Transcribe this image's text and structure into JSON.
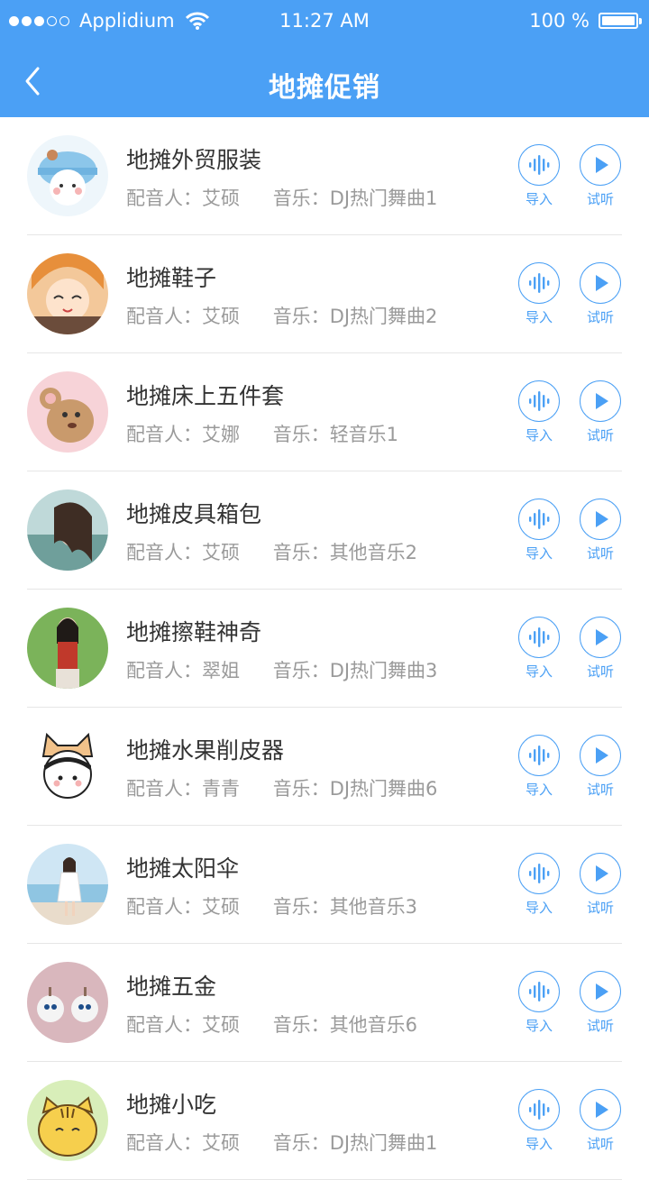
{
  "status": {
    "carrier": "Applidium",
    "time": "11:27 AM",
    "battery": "100 %"
  },
  "nav": {
    "title": "地摊促销"
  },
  "labels": {
    "voice_prefix": "配音人：",
    "music_prefix": "音乐：",
    "import": "导入",
    "listen": "试听"
  },
  "colors": {
    "accent": "#4ba0f5"
  },
  "items": [
    {
      "title": "地摊外贸服装",
      "voice": "艾硕",
      "music": "DJ热门舞曲1",
      "avatar": "bear-hat-cartoon"
    },
    {
      "title": "地摊鞋子",
      "voice": "艾硕",
      "music": "DJ热门舞曲2",
      "avatar": "anime-girl"
    },
    {
      "title": "地摊床上五件套",
      "voice": "艾娜",
      "music": "轻音乐1",
      "avatar": "cartoon-mouse"
    },
    {
      "title": "地摊皮具箱包",
      "voice": "艾硕",
      "music": "其他音乐2",
      "avatar": "girl-photo"
    },
    {
      "title": "地摊擦鞋神奇",
      "voice": "翠姐",
      "music": "DJ热门舞曲3",
      "avatar": "girl-green-wall"
    },
    {
      "title": "地摊水果削皮器",
      "voice": "青青",
      "music": "DJ热门舞曲6",
      "avatar": "cat-hat-girl"
    },
    {
      "title": "地摊太阳伞",
      "voice": "艾硕",
      "music": "其他音乐3",
      "avatar": "girl-beach"
    },
    {
      "title": "地摊五金",
      "voice": "艾硕",
      "music": "其他音乐6",
      "avatar": "earrings"
    },
    {
      "title": "地摊小吃",
      "voice": "艾硕",
      "music": "DJ热门舞曲1",
      "avatar": "tiger-cartoon"
    }
  ]
}
